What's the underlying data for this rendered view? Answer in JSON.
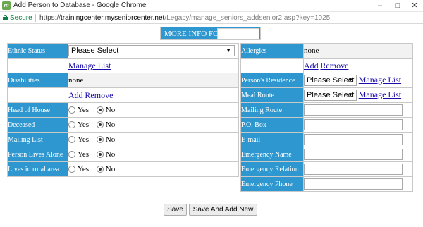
{
  "window": {
    "title": "Add Person to Database - Google Chrome",
    "app_icon_letter": "m",
    "secure_label": "Secure",
    "url_scheme": "https://",
    "url_host": "trainingcenter.myseniorcenter.net",
    "url_path": "/Legacy/manage_seniors_addsenior2.asp?key=1025"
  },
  "header": {
    "more_info_label": "MORE INFO FOR",
    "more_info_value": ""
  },
  "left": {
    "ethnic_status_label": "Ethnic Status",
    "ethnic_status_value": "Please Select",
    "manage_list_link": "Manage List",
    "disabilities_label": "Disabilities",
    "disabilities_value": "none",
    "add_link": "Add",
    "remove_link": "Remove",
    "yes_label": "Yes",
    "no_label": "No",
    "radios": [
      {
        "label": "Head of House",
        "selected": "No"
      },
      {
        "label": "Deceased",
        "selected": "No"
      },
      {
        "label": "Mailing List",
        "selected": "No"
      },
      {
        "label": "Person Lives Alone",
        "selected": "No"
      },
      {
        "label": "Lives in rural area",
        "selected": "No"
      }
    ]
  },
  "right": {
    "allergies_label": "Allergies",
    "allergies_value": "none",
    "add_link": "Add",
    "remove_link": "Remove",
    "residence_label": "Person's Residence",
    "residence_value": "Please Select",
    "residence_manage_link": "Manage List",
    "meal_route_label": "Meal Route",
    "meal_route_value": "Please Select",
    "meal_route_manage_link": "Manage List",
    "fields": [
      {
        "label": "Mailing Route",
        "value": ""
      },
      {
        "label": "P.O. Box",
        "value": ""
      },
      {
        "label": "E-mail",
        "value": ""
      },
      {
        "label": "Emergency Name",
        "value": ""
      },
      {
        "label": "Emergency Relation",
        "value": ""
      },
      {
        "label": "Emergency Phone",
        "value": ""
      }
    ]
  },
  "buttons": {
    "save": "Save",
    "save_add_new": "Save And Add New"
  },
  "colors": {
    "label_bg": "#2e97cf",
    "link": "#1a0dab",
    "secure": "#0b8043"
  },
  "icons": {
    "lock": "lock-icon",
    "minimize": "minimize-icon",
    "maximize": "maximize-icon",
    "close": "close-icon"
  }
}
